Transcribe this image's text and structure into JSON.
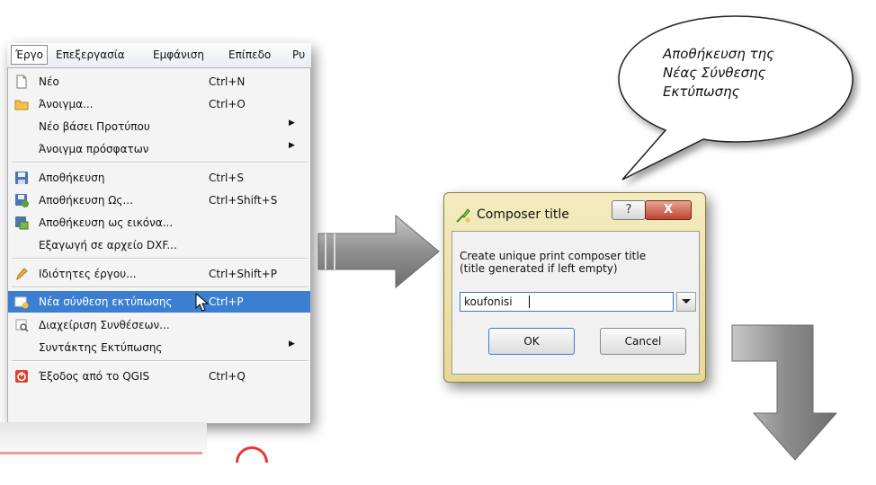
{
  "menubar": {
    "items": [
      "Έργο",
      "Επεξεργασία",
      "Εμφάνιση",
      "Επίπεδο",
      "Ρυ"
    ]
  },
  "menu": {
    "items": [
      {
        "label": "Νέο",
        "shortcut": "Ctrl+N",
        "icon": "new-file-icon"
      },
      {
        "label": "Άνοιγμα...",
        "shortcut": "Ctrl+O",
        "icon": "folder-icon"
      },
      {
        "label": "Νέο βάσει Προτύπου",
        "shortcut": "",
        "submenu": true
      },
      {
        "label": "Άνοιγμα πρόσφατων",
        "shortcut": "",
        "submenu": true
      },
      {
        "label": "Αποθήκευση",
        "shortcut": "Ctrl+S",
        "icon": "save-icon"
      },
      {
        "label": "Αποθήκευση Ως...",
        "shortcut": "Ctrl+Shift+S",
        "icon": "save-as-icon"
      },
      {
        "label": "Αποθήκευση ως εικόνα...",
        "shortcut": "",
        "icon": "save-image-icon"
      },
      {
        "label": "Εξαγωγή σε αρχείο DXF...",
        "shortcut": ""
      },
      {
        "label": "Ιδιότητες έργου...",
        "shortcut": "Ctrl+Shift+P",
        "icon": "pencil-icon"
      },
      {
        "label": "Νέα σύνθεση εκτύπωσης",
        "shortcut": "Ctrl+P",
        "icon": "new-composer-icon",
        "highlighted": true
      },
      {
        "label": "Διαχείριση Συνθέσεων...",
        "shortcut": "",
        "icon": "composer-manager-icon"
      },
      {
        "label": "Συντάκτης Εκτύπωσης",
        "shortcut": "",
        "submenu": true
      },
      {
        "label": "Έξοδος από το QGIS",
        "shortcut": "Ctrl+Q",
        "icon": "exit-icon"
      }
    ]
  },
  "bubble": {
    "text": "Αποθήκευση της\nΝέας Σύνθεσης\nΕκτύπωσης"
  },
  "dialog": {
    "title": "Composer title",
    "help_label": "?",
    "close_label": "X",
    "prompt": "Create unique print composer title\n(title generated if left empty)",
    "input_value": "koufonisi",
    "ok_label": "OK",
    "cancel_label": "Cancel"
  },
  "colors": {
    "highlight": "#3c7fd0",
    "dialog_frame": "#e6d894",
    "arrow": "#8c8c8c"
  }
}
